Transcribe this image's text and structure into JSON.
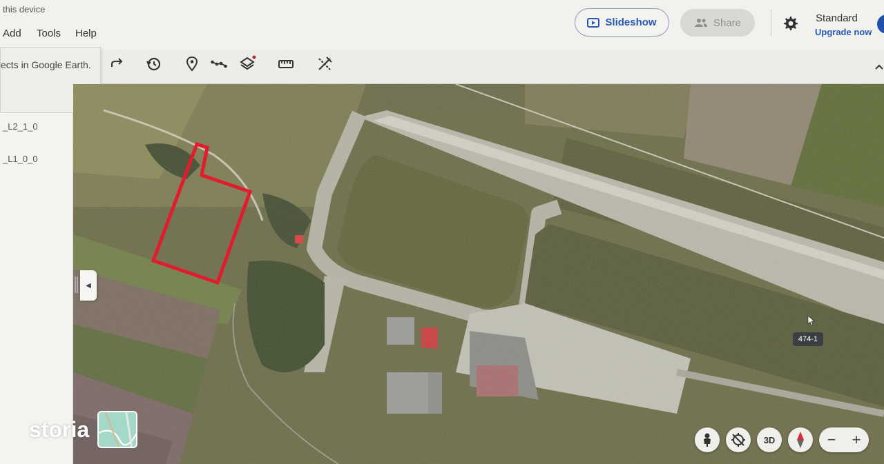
{
  "header": {
    "device_text": "this device",
    "menu": [
      "Add",
      "Tools",
      "Help"
    ],
    "slideshow_label": "Slideshow",
    "share_label": "Share",
    "plan_title": "Standard",
    "upgrade_label": "Upgrade now"
  },
  "toolbar": {
    "tooltip_text": "ects in Google Earth.",
    "icons": [
      "redo-icon",
      "history-icon",
      "placemark-icon",
      "path-icon",
      "layers-icon",
      "measure-icon",
      "tools-icon"
    ]
  },
  "sidepanel": {
    "layers": [
      "_L2_1_0",
      "_L1_0_0"
    ]
  },
  "map": {
    "tag_label": "474-1",
    "controls": [
      "pegman-icon",
      "compass-reset-icon",
      "3D",
      "compass-icon"
    ],
    "zoom_out": "−",
    "zoom_in": "+",
    "boundary_color": "#e21c2c"
  },
  "watermark": {
    "text": "storia"
  }
}
